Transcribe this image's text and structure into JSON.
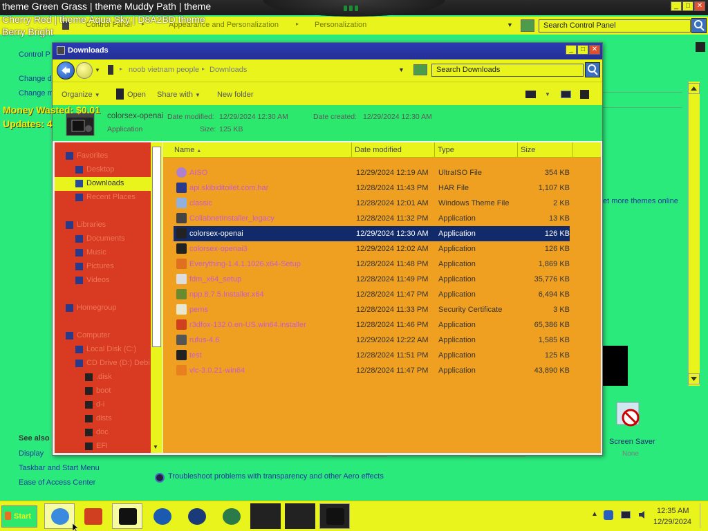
{
  "overlay": {
    "line1": "theme Green Grass | theme Muddy Path | theme",
    "line2": "Cherry Red | theme Aqua Sky | D8A2BD theme",
    "line3": "Berry Bright",
    "money": "Money Wasted: $0.01",
    "updates": "Updates: 4"
  },
  "control_panel": {
    "crumbs": [
      "Control Panel",
      "Appearance and Personalization",
      "Personalization"
    ],
    "search_placeholder": "Search Control Panel",
    "left_links": [
      "Control P",
      "Change d",
      "Change m"
    ],
    "get_more_themes": "et more themes online",
    "see_also": "See also",
    "see_also_links": [
      "Display",
      "Taskbar and Start Menu",
      "Ease of Access Center"
    ],
    "screen_saver_label": "Screen Saver",
    "screen_saver_value": "None",
    "trouble_link": "Troubleshoot problems with transparency and other Aero effects"
  },
  "explorer": {
    "title": "Downloads",
    "path": [
      "noob vietnam people",
      "Downloads"
    ],
    "search_placeholder": "Search Downloads",
    "commands": {
      "organize": "Organize",
      "open": "Open",
      "share_with": "Share with",
      "new_folder": "New folder"
    },
    "details": {
      "name": "colorsex-openai",
      "date_modified_label": "Date modified:",
      "date_modified": "12/29/2024 12:30 AM",
      "date_created_label": "Date created:",
      "date_created": "12/29/2024 12:30 AM",
      "type": "Application",
      "size_label": "Size:",
      "size": "125 KB"
    },
    "nav": [
      {
        "label": "Favorites",
        "indent": 0,
        "icon": "star-icon"
      },
      {
        "label": "Desktop",
        "indent": 1,
        "icon": "desktop-icon"
      },
      {
        "label": "Downloads",
        "indent": 1,
        "icon": "downloads-icon",
        "selected": true
      },
      {
        "label": "Recent Places",
        "indent": 1,
        "icon": "recent-places-icon"
      },
      {
        "label": "",
        "indent": 0,
        "icon": ""
      },
      {
        "label": "Libraries",
        "indent": 0,
        "icon": "libraries-icon"
      },
      {
        "label": "Documents",
        "indent": 1,
        "icon": "documents-icon"
      },
      {
        "label": "Music",
        "indent": 1,
        "icon": "music-icon"
      },
      {
        "label": "Pictures",
        "indent": 1,
        "icon": "pictures-icon"
      },
      {
        "label": "Videos",
        "indent": 1,
        "icon": "videos-icon"
      },
      {
        "label": "",
        "indent": 0,
        "icon": ""
      },
      {
        "label": "Homegroup",
        "indent": 0,
        "icon": "homegroup-icon"
      },
      {
        "label": "",
        "indent": 0,
        "icon": ""
      },
      {
        "label": "Computer",
        "indent": 0,
        "icon": "computer-icon"
      },
      {
        "label": "Local Disk (C:)",
        "indent": 1,
        "icon": "drive-icon"
      },
      {
        "label": "CD Drive (D:) Debi",
        "indent": 1,
        "icon": "cd-drive-icon"
      },
      {
        "label": ".disk",
        "indent": 2,
        "icon": "folder-icon"
      },
      {
        "label": "boot",
        "indent": 2,
        "icon": "folder-icon"
      },
      {
        "label": "d-i",
        "indent": 2,
        "icon": "folder-icon"
      },
      {
        "label": "dists",
        "indent": 2,
        "icon": "folder-icon"
      },
      {
        "label": "doc",
        "indent": 2,
        "icon": "folder-icon"
      },
      {
        "label": "EFI",
        "indent": 2,
        "icon": "folder-icon"
      }
    ],
    "columns": [
      "Name",
      "Date modified",
      "Type",
      "Size"
    ],
    "files": [
      {
        "name": "AISO",
        "date": "12/29/2024 12:19 AM",
        "type": "UltraISO File",
        "size": "354 KB",
        "icon": "disc-icon"
      },
      {
        "name": "api.skibiditoilet.com.har",
        "date": "12/28/2024 11:43 PM",
        "type": "HAR File",
        "size": "1,107 KB",
        "icon": "file-icon"
      },
      {
        "name": "classic",
        "date": "12/28/2024 12:01 AM",
        "type": "Windows Theme File",
        "size": "2 KB",
        "icon": "theme-icon"
      },
      {
        "name": "CollabnetInstaller_legacy",
        "date": "12/28/2024 11:32 PM",
        "type": "Application",
        "size": "13 KB",
        "icon": "installer-icon"
      },
      {
        "name": "colorsex-openai",
        "date": "12/29/2024 12:30 AM",
        "type": "Application",
        "size": "126 KB",
        "icon": "app-icon",
        "selected": true
      },
      {
        "name": "colorsex-openai3",
        "date": "12/29/2024 12:02 AM",
        "type": "Application",
        "size": "126 KB",
        "icon": "app-icon"
      },
      {
        "name": "Everything-1.4.1.1026.x64-Setup",
        "date": "12/28/2024 11:48 PM",
        "type": "Application",
        "size": "1,869 KB",
        "icon": "search-app-icon"
      },
      {
        "name": "fdm_x64_setup",
        "date": "12/28/2024 11:49 PM",
        "type": "Application",
        "size": "35,776 KB",
        "icon": "download-manager-icon"
      },
      {
        "name": "npp.8.7.5.Installer.x64",
        "date": "12/28/2024 11:47 PM",
        "type": "Application",
        "size": "6,494 KB",
        "icon": "notepad-icon"
      },
      {
        "name": "pems",
        "date": "12/28/2024 11:33 PM",
        "type": "Security Certificate",
        "size": "3 KB",
        "icon": "certificate-icon"
      },
      {
        "name": "r3dfox-132.0.en-US.win64.installer",
        "date": "12/28/2024 11:46 PM",
        "type": "Application",
        "size": "65,386 KB",
        "icon": "fox-icon"
      },
      {
        "name": "rufus-4.6",
        "date": "12/29/2024 12:22 AM",
        "type": "Application",
        "size": "1,585 KB",
        "icon": "usb-icon"
      },
      {
        "name": "test",
        "date": "12/28/2024 11:51 PM",
        "type": "Application",
        "size": "125 KB",
        "icon": "app-icon"
      },
      {
        "name": "vlc-3.0.21-win64",
        "date": "12/28/2024 11:47 PM",
        "type": "Application",
        "size": "43,890 KB",
        "icon": "vlc-icon"
      }
    ]
  },
  "taskbar": {
    "start": "Start",
    "time": "12:35 AM",
    "date": "12/29/2024",
    "apps": [
      "ie-icon",
      "red-app-icon",
      "black-app-icon",
      "media-player-icon",
      "globe-icon",
      "magnifier-icon",
      "window-app-icon",
      "monitor-app-icon",
      "activity-app-icon"
    ]
  },
  "colors": {
    "bg": "#2bea7c",
    "yellow": "#e8f41c",
    "nav": "#d83a22",
    "filelist": "#f0a020",
    "selection": "#102a6a"
  }
}
